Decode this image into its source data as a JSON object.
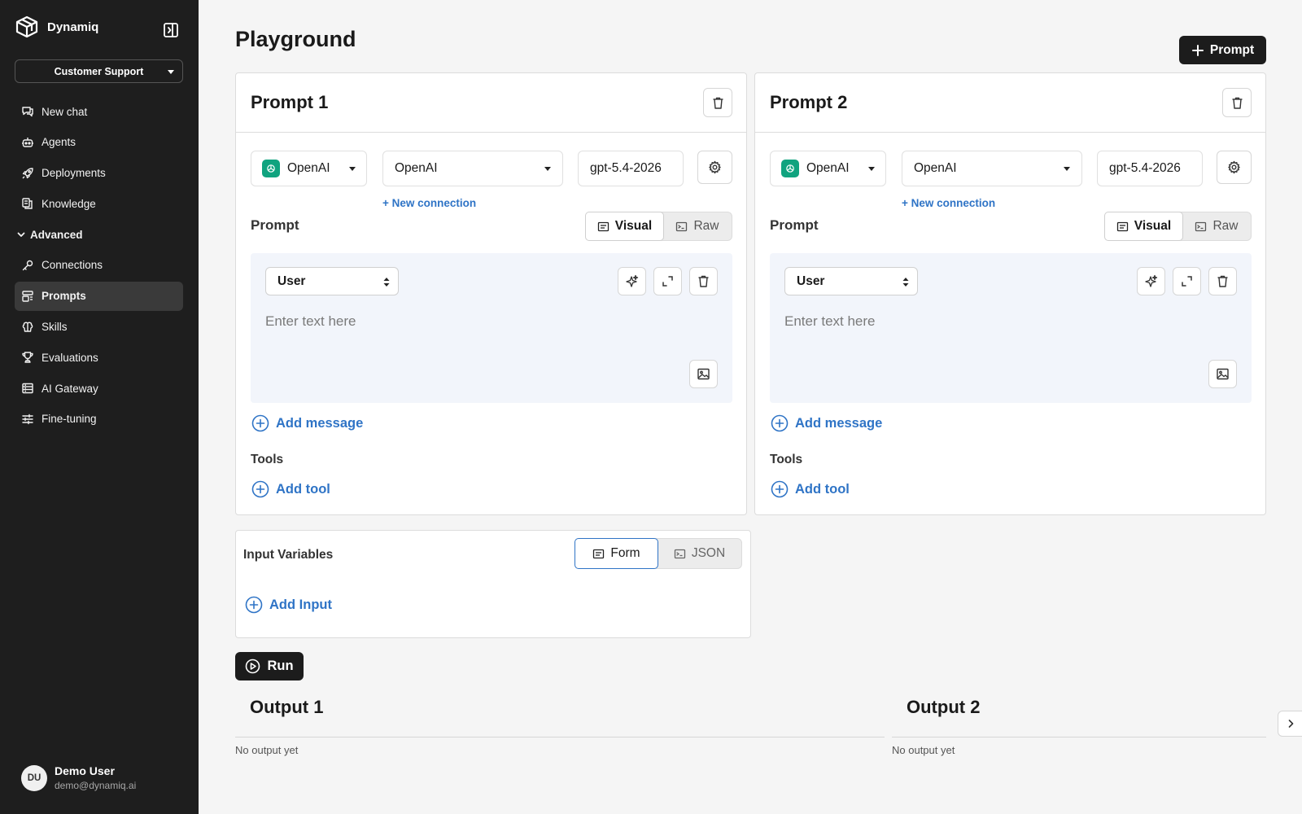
{
  "app": {
    "name": "Dynamiq"
  },
  "sidebar": {
    "project": "Customer Support",
    "items": [
      {
        "label": "New chat",
        "icon": "chat-icon"
      },
      {
        "label": "Agents",
        "icon": "robot-icon"
      },
      {
        "label": "Deployments",
        "icon": "rocket-icon"
      },
      {
        "label": "Knowledge",
        "icon": "knowledge-icon"
      }
    ],
    "section": {
      "label": "Advanced"
    },
    "advanced_items": [
      {
        "label": "Connections",
        "icon": "key-icon"
      },
      {
        "label": "Prompts",
        "icon": "prompts-icon",
        "active": true
      },
      {
        "label": "Skills",
        "icon": "brain-icon"
      },
      {
        "label": "Evaluations",
        "icon": "trophy-icon"
      },
      {
        "label": "AI Gateway",
        "icon": "gateway-icon"
      },
      {
        "label": "Fine-tuning",
        "icon": "sliders-icon"
      }
    ],
    "user": {
      "initials": "DU",
      "name": "Demo User",
      "email": "demo@dynamiq.ai"
    }
  },
  "main": {
    "title": "Playground",
    "add_prompt_label": "Prompt",
    "prompts": [
      {
        "title": "Prompt 1",
        "provider": "OpenAI",
        "connection": "OpenAI",
        "model": "gpt-5.4-2026",
        "new_connection": "+ New connection",
        "prompt_label": "Prompt",
        "mode_visual": "Visual",
        "mode_raw": "Raw",
        "role": "User",
        "placeholder": "Enter text here",
        "add_message": "Add message",
        "tools_label": "Tools",
        "add_tool": "Add tool"
      },
      {
        "title": "Prompt 2",
        "provider": "OpenAI",
        "connection": "OpenAI",
        "model": "gpt-5.4-2026",
        "new_connection": "+ New connection",
        "prompt_label": "Prompt",
        "mode_visual": "Visual",
        "mode_raw": "Raw",
        "role": "User",
        "placeholder": "Enter text here",
        "add_message": "Add message",
        "tools_label": "Tools",
        "add_tool": "Add tool"
      }
    ],
    "input_variables": {
      "title": "Input Variables",
      "mode_form": "Form",
      "mode_json": "JSON",
      "add_input": "Add Input"
    },
    "run_label": "Run",
    "outputs": [
      {
        "title": "Output 1",
        "empty": "No output yet"
      },
      {
        "title": "Output 2",
        "empty": "No output yet"
      }
    ]
  },
  "colors": {
    "sidebar_bg": "#1e1e1e",
    "accent_link": "#2f74c6",
    "openai_green": "#10a37f",
    "primary_button": "#1c1c1c"
  }
}
